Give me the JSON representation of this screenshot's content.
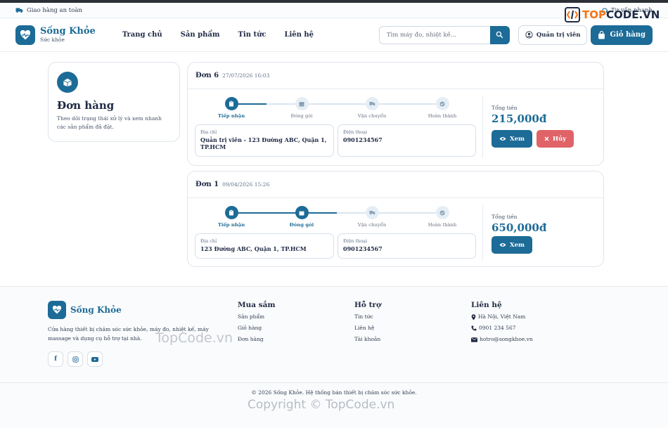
{
  "topstrip": {
    "shipping": "Giao hàng an toàn",
    "consult": "Tư vấn nhanh"
  },
  "header": {
    "brand_name": "Sống Khỏe",
    "brand_sub": "Sức khỏe",
    "nav": [
      "Trang chủ",
      "Sản phẩm",
      "Tin tức",
      "Liên hệ"
    ],
    "search_placeholder": "Tìm máy đo, nhiệt kế...",
    "admin_label": "Quản trị viên",
    "cart_label": "Giỏ hàng"
  },
  "sidebar": {
    "title": "Đơn hàng",
    "desc": "Theo dõi trạng thái xử lý và xem nhanh các sản phẩm đã đặt."
  },
  "step_labels": [
    "Tiếp nhận",
    "Đóng gói",
    "Vận chuyển",
    "Hoàn thành"
  ],
  "labels": {
    "address": "Địa chỉ",
    "phone": "Điện thoại",
    "total": "Tổng tiền",
    "view": "Xem",
    "cancel": "Hủy"
  },
  "orders": [
    {
      "code": "Đơn 6",
      "date": "27/07/2026 16:03",
      "progress_step": 1,
      "address": "Quản trị viên - 123 Đường ABC, Quận 1, TP.HCM",
      "phone": "0901234567",
      "total": "215,000đ",
      "can_cancel": true
    },
    {
      "code": "Đơn 1",
      "date": "09/04/2026 15:26",
      "progress_step": 2,
      "address": "123 Đường ABC, Quận 1, TP.HCM",
      "phone": "0901234567",
      "total": "650,000đ",
      "can_cancel": false
    }
  ],
  "footer": {
    "brand_name": "Sống Khỏe",
    "desc": "Cửa hàng thiết bị chăm sóc sức khỏe, máy đo, nhiệt kế, máy massage và dụng cụ hỗ trợ tại nhà.",
    "col_shop": {
      "title": "Mua sắm",
      "items": [
        "Sản phẩm",
        "Giỏ hàng",
        "Đơn hàng"
      ]
    },
    "col_support": {
      "title": "Hỗ trợ",
      "items": [
        "Tin tức",
        "Liên hệ",
        "Tài khoản"
      ]
    },
    "col_contact": {
      "title": "Liên hệ",
      "address": "Hà Nội, Việt Nam",
      "phone": "0901 234 567",
      "email": "hotro@songkhoe.vn"
    },
    "copyright": "© 2026 Sống Khỏe. Hệ thống bán thiết bị chăm sóc sức khỏe."
  },
  "watermarks": {
    "logo": "TOPCODE.VN",
    "logo_a": "TOP",
    "logo_b": "CODE.VN",
    "mid": "TopCode.vn",
    "bottom": "Copyright © TopCode.vn"
  },
  "colors": {
    "primary": "#1d6b97",
    "danger": "#e06367",
    "text": "#1f2a44"
  }
}
